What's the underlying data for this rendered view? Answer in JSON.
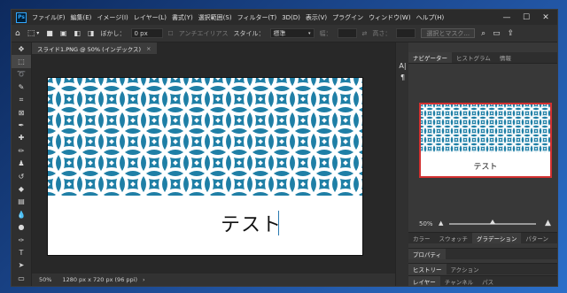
{
  "menubar": {
    "logo": "Ps",
    "items": [
      "ファイル(F)",
      "編集(E)",
      "イメージ(I)",
      "レイヤー(L)",
      "書式(Y)",
      "選択範囲(S)",
      "フィルター(T)",
      "3D(D)",
      "表示(V)",
      "プラグイン",
      "ウィンドウ(W)",
      "ヘルプ(H)"
    ],
    "controls": [
      "—",
      "☐",
      "✕"
    ]
  },
  "options": {
    "blur_label": "ぼかし：",
    "blur_value": "0 px",
    "antialias_label": "アンチエイリアス",
    "style_label": "スタイル：",
    "style_value": "標準",
    "width_label": "幅：",
    "height_label": "高さ：",
    "select_mask_label": "選択とマスク..."
  },
  "document": {
    "tab_title": "スライド1.PNG @ 50% (インデックス)",
    "close": "×",
    "text": "テスト",
    "pattern_color": "#1f7fa6"
  },
  "status": {
    "zoom": "50%",
    "info": "1280 px x 720 px (96 ppi)"
  },
  "panels": {
    "top_tabs": [
      "ナビゲーター",
      "ヒストグラム",
      "情報"
    ],
    "nav_zoom": "50%",
    "nav_zoom_level": 0.5,
    "row1_tabs": [
      "カラー",
      "スウォッチ",
      "グラデーション",
      "パターン"
    ],
    "row2_tabs": [
      "プロパティ"
    ],
    "row3_tabs": [
      "ヒストリー",
      "アクション"
    ],
    "row4_tabs": [
      "レイヤー",
      "チャンネル",
      "パス"
    ]
  }
}
